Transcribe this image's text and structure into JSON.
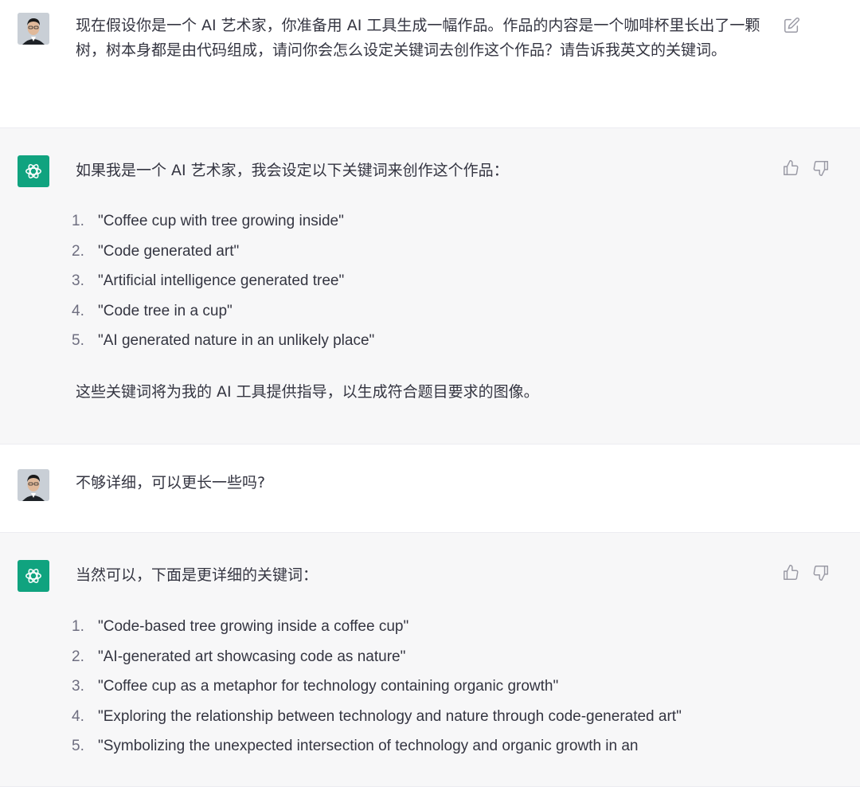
{
  "messages": [
    {
      "role": "user",
      "text": "现在假设你是一个 AI 艺术家，你准备用 AI 工具生成一幅作品。作品的内容是一个咖啡杯里长出了一颗树，树本身都是由代码组成，请问你会怎么设定关键词去创作这个作品？请告诉我英文的关键词。"
    },
    {
      "role": "assistant",
      "intro": "如果我是一个 AI 艺术家，我会设定以下关键词来创作这个作品：",
      "items": [
        {
          "num": "1.",
          "text": "\"Coffee cup with tree growing inside\""
        },
        {
          "num": "2.",
          "text": "\"Code generated art\""
        },
        {
          "num": "3.",
          "text": "\"Artificial intelligence generated tree\""
        },
        {
          "num": "4.",
          "text": "\"Code tree in a cup\""
        },
        {
          "num": "5.",
          "text": "\"AI generated nature in an unlikely place\""
        }
      ],
      "outro": "这些关键词将为我的 AI 工具提供指导，以生成符合题目要求的图像。"
    },
    {
      "role": "user",
      "text": "不够详细，可以更长一些吗?"
    },
    {
      "role": "assistant",
      "intro": "当然可以，下面是更详细的关键词：",
      "items": [
        {
          "num": "1.",
          "text": "\"Code-based tree growing inside a coffee cup\""
        },
        {
          "num": "2.",
          "text": "\"AI-generated art showcasing code as nature\""
        },
        {
          "num": "3.",
          "text": "\"Coffee cup as a metaphor for technology containing organic growth\""
        },
        {
          "num": "4.",
          "text": "\"Exploring the relationship between technology and nature through code-generated art\""
        },
        {
          "num": "5.",
          "text": "\"Symbolizing the unexpected intersection of technology and organic growth in an"
        }
      ]
    }
  ],
  "icons": {
    "edit": "edit-icon",
    "thumbs_up": "thumbs-up-icon",
    "thumbs_down": "thumbs-down-icon",
    "assistant_logo": "openai-logo-icon",
    "user_avatar": "user-avatar"
  },
  "colors": {
    "assistant_bg": "#f7f7f8",
    "brand": "#10a37f",
    "text": "#343541",
    "muted": "#6e6e80"
  }
}
